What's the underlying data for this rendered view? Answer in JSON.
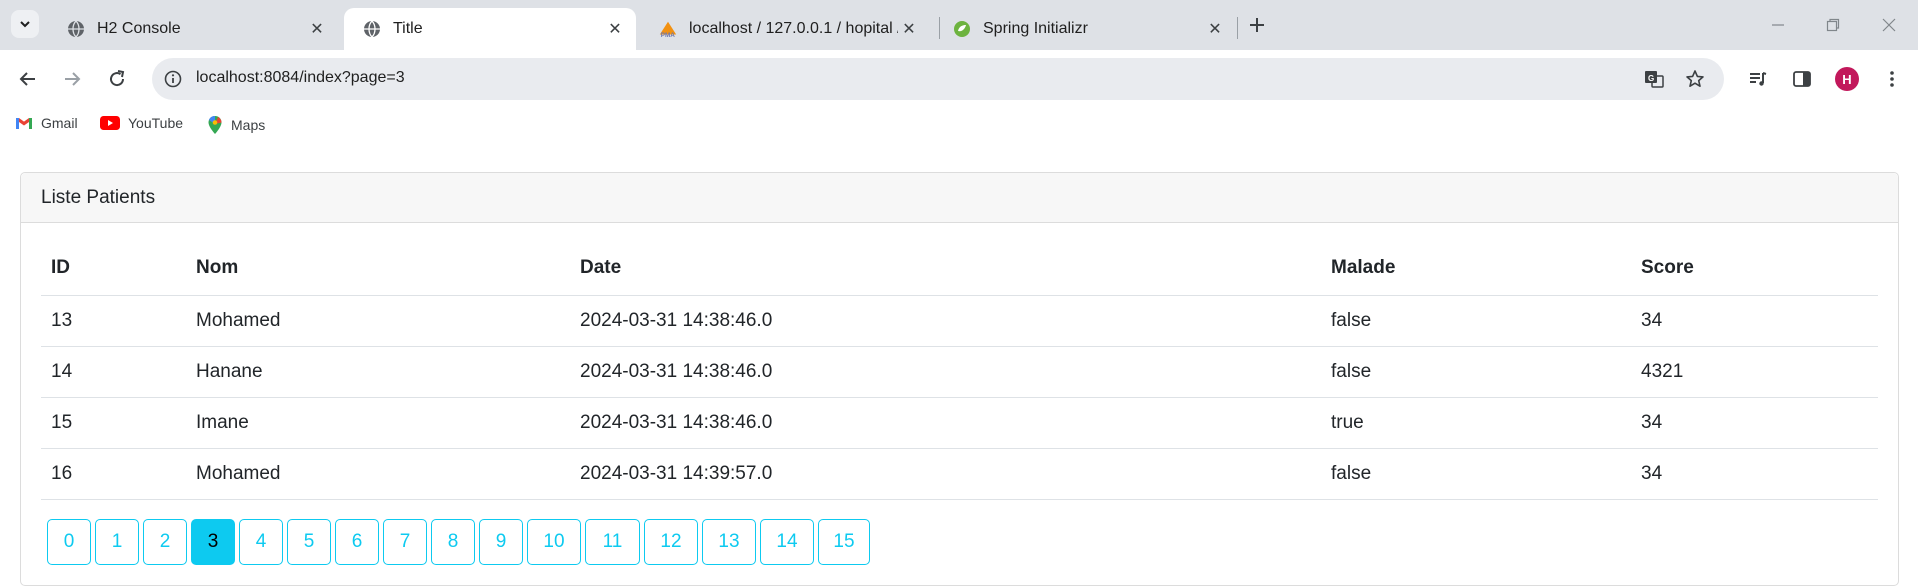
{
  "browser": {
    "tabs": [
      {
        "title": "H2 Console",
        "icon": "globe-icon",
        "active": false
      },
      {
        "title": "Title",
        "icon": "globe-icon",
        "active": true
      },
      {
        "title": "localhost / 127.0.0.1 / hopital / ¡",
        "icon": "phpmyadmin-icon",
        "active": false
      },
      {
        "title": "Spring Initializr",
        "icon": "spring-icon",
        "active": false
      }
    ],
    "address": "localhost:8084/index?page=3",
    "profile_initial": "H",
    "bookmarks": [
      {
        "label": "Gmail",
        "icon": "gmail-icon"
      },
      {
        "label": "YouTube",
        "icon": "youtube-icon"
      },
      {
        "label": "Maps",
        "icon": "maps-icon"
      }
    ]
  },
  "page": {
    "card_title": "Liste Patients",
    "columns": [
      "ID",
      "Nom",
      "Date",
      "Malade",
      "Score"
    ],
    "rows": [
      [
        "13",
        "Mohamed",
        "2024-03-31 14:38:46.0",
        "false",
        "34"
      ],
      [
        "14",
        "Hanane",
        "2024-03-31 14:38:46.0",
        "false",
        "4321"
      ],
      [
        "15",
        "Imane",
        "2024-03-31 14:38:46.0",
        "true",
        "34"
      ],
      [
        "16",
        "Mohamed",
        "2024-03-31 14:39:57.0",
        "false",
        "34"
      ]
    ],
    "pages": [
      "0",
      "1",
      "2",
      "3",
      "4",
      "5",
      "6",
      "7",
      "8",
      "9",
      "10",
      "11",
      "12",
      "13",
      "14",
      "15"
    ],
    "current_page": "3"
  },
  "colors": {
    "accent": "#0dcaf0",
    "tab_strip": "#dee1e6",
    "avatar": "#c2185b"
  }
}
